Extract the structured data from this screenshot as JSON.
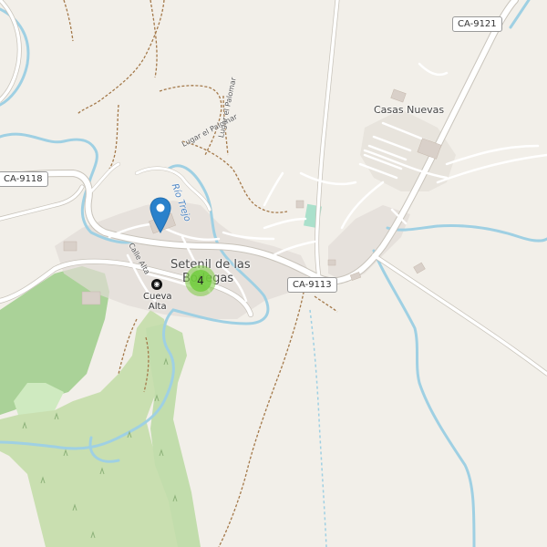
{
  "map": {
    "roads": {
      "ca9121": "CA-9121",
      "ca9118": "CA-9118",
      "ca9113": "CA-9113"
    },
    "places": {
      "town_line1": "Setenil de las",
      "town_line2": "Bodegas",
      "hamlet": "Casas Nuevas",
      "poi_line1": "Cueva",
      "poi_line2": "Alta"
    },
    "streets": {
      "lugar1": "Lugar el Palomar",
      "lugar2": "Lugar el Palomar",
      "calle_alta": "Calle Alta"
    },
    "river": "Río Trejo",
    "cluster_count": "4",
    "icons": {
      "marker": "location-pin-icon",
      "poi": "cave-icon"
    },
    "colors": {
      "background": "#f2efe9",
      "road": "#ffffff",
      "road_casing": "#c8c3ba",
      "water": "#9fd0e3",
      "forest": "#8fd67f",
      "grass": "#cfe9b5",
      "marker": "#2a81cb",
      "cluster": "#6ecc39",
      "track": "#a4794a"
    }
  }
}
